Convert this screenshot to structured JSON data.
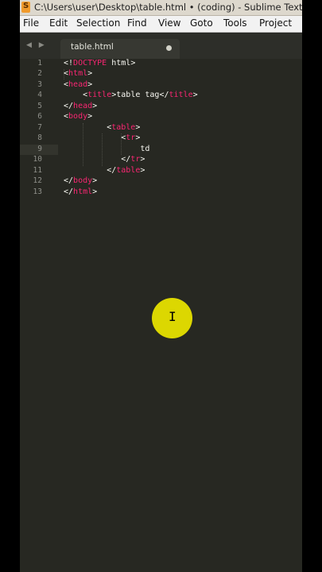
{
  "window": {
    "title": "C:\\Users\\user\\Desktop\\table.html • (coding) - Sublime Text (U",
    "app_icon": "sublime-text-icon"
  },
  "menu": [
    "File",
    "Edit",
    "Selection",
    "Find",
    "View",
    "Goto",
    "Tools",
    "Project"
  ],
  "tab": {
    "label": "table.html",
    "arrows": "◀ ▶"
  },
  "editor": {
    "line_numbers": [
      "1",
      "2",
      "3",
      "4",
      "5",
      "6",
      "7",
      "8",
      "9",
      "10",
      "11",
      "12",
      "13"
    ],
    "active_line": 9,
    "lines": [
      "<!DOCTYPE html>",
      "<html>",
      "<head>",
      "    <title>table tag</title>",
      "</head>",
      "<body>",
      "         <table>",
      "            <tr>",
      "                td",
      "            </tr>",
      "         </table>",
      "</body>",
      "</html>"
    ]
  },
  "colors": {
    "background": "#272822",
    "tag": "#f92672",
    "text": "#f8f8f2",
    "gutter": "#8f908a",
    "cursor_highlight": "#e6e000"
  },
  "cursor_icon": "text-ibeam-icon"
}
